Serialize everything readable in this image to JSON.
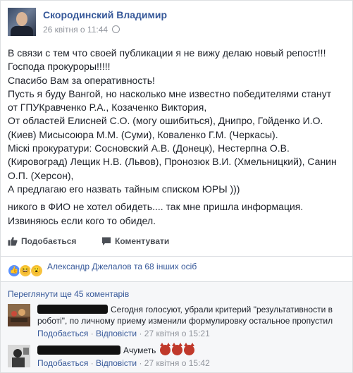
{
  "post": {
    "author": "Скородинский Владимир",
    "timestamp": "26 квітня о 11:44",
    "lines": [
      "В связи с тем что своей публикации я не вижу делаю новый репост!!!",
      "Господа прокуроры!!!!!",
      "Спасибо Вам за оперативность!",
      "Пусть я буду Вангой, но насколько мне известно победителями станут",
      "от ГПУКравченко Р.А., Козаченко Виктория,",
      "От областей Елисней С.О. (могу ошибиться), Днипро, Гойденко И.О.",
      "(Киев) Мисысоюра М.М. (Суми), Коваленко Г.М. (Черкасы).",
      "Міскі прокуратури: Сосновский А.В. (Донецк), Нестерпна О.В.",
      "(Кировоград) Лещик Н.В. (Львов), Пронозюк В.И. (Хмельницкий), Санин",
      "О.П. (Херсон),",
      "А предлагаю его назвать тайным списком ЮРЫ )))",
      "никого в ФИО не хотел обидеть.... так мне пришла информация.",
      "Извиняюсь если кого то обидел."
    ]
  },
  "actions": {
    "share_label": "Подобається",
    "comment_label": "Коментувати"
  },
  "reactions": {
    "icons": [
      "like-icon",
      "haha-icon",
      "wow-icon"
    ],
    "names_text": "Александр Джелалов та 68 інших осіб"
  },
  "comments": {
    "more_label": "Переглянути ще 45 коментарів",
    "items": [
      {
        "text": "Сегодня голосуют, убрали критерий \"результативности в роботі\", по личному приему изменили формулировку остальное пропустил",
        "like_label": "Подобається",
        "reply_label": "Відповісти",
        "time": "27 квітня о 15:21"
      },
      {
        "text": "Ачуметь",
        "like_label": "Подобається",
        "reply_label": "Відповісти",
        "time": "27 квітня о 15:42"
      }
    ]
  },
  "colors": {
    "link": "#365899",
    "meta": "#90949c",
    "text": "#1d2129"
  }
}
